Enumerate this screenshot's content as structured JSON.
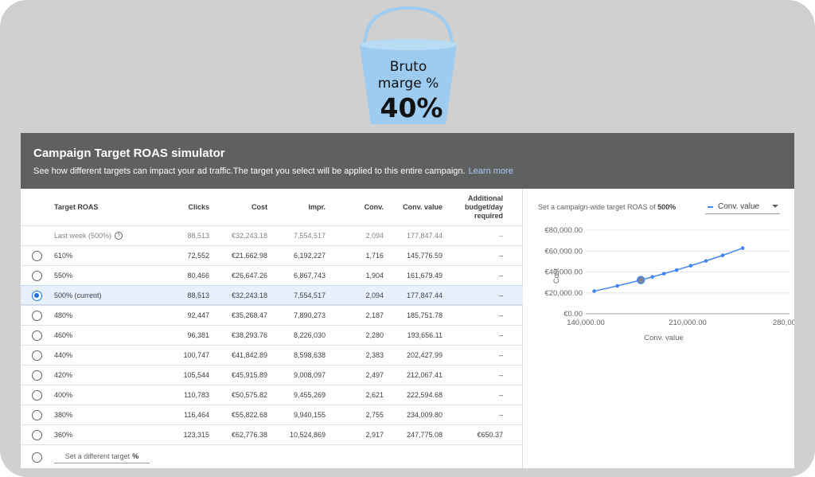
{
  "bucket": {
    "line1": "Bruto",
    "line2": "marge %",
    "percent": "40%",
    "color": "#9ecbf0"
  },
  "simulator": {
    "title": "Campaign Target ROAS simulator",
    "subtitle": "See how different targets can impact your ad traffic.The target you select will be applied to this entire campaign.",
    "learn_more": "Learn more"
  },
  "table": {
    "headers": {
      "target": "Target ROAS",
      "clicks": "Clicks",
      "cost": "Cost",
      "impr": "Impr.",
      "conv": "Conv.",
      "conv_value": "Conv. value",
      "budget1": "Additional",
      "budget2": "budget/day",
      "budget3": "required"
    },
    "last_week": {
      "target": "Last week (500%)",
      "clicks": "88,513",
      "cost": "€32,243.18",
      "impr": "7,554,517",
      "conv": "2,094",
      "conv_value": "177,847.44",
      "budget": "–"
    },
    "rows": [
      {
        "target": "610%",
        "clicks": "72,552",
        "cost": "€21,662.98",
        "impr": "6,192,227",
        "conv": "1,716",
        "conv_value": "145,776.59",
        "budget": "–"
      },
      {
        "target": "550%",
        "clicks": "80,466",
        "cost": "€26,647.26",
        "impr": "6,867,743",
        "conv": "1,904",
        "conv_value": "161,679.49",
        "budget": "–"
      },
      {
        "target": "500% (current)",
        "clicks": "88,513",
        "cost": "€32,243.18",
        "impr": "7,554,517",
        "conv": "2,094",
        "conv_value": "177,847.44",
        "budget": "–"
      },
      {
        "target": "480%",
        "clicks": "92,447",
        "cost": "€35,268.47",
        "impr": "7,890,273",
        "conv": "2,187",
        "conv_value": "185,751.78",
        "budget": "–"
      },
      {
        "target": "460%",
        "clicks": "96,381",
        "cost": "€38,293.76",
        "impr": "8,226,030",
        "conv": "2,280",
        "conv_value": "193,656.11",
        "budget": "–"
      },
      {
        "target": "440%",
        "clicks": "100,747",
        "cost": "€41,842.89",
        "impr": "8,598,638",
        "conv": "2,383",
        "conv_value": "202,427.99",
        "budget": "–"
      },
      {
        "target": "420%",
        "clicks": "105,544",
        "cost": "€45,915.89",
        "impr": "9,008,097",
        "conv": "2,497",
        "conv_value": "212,067.41",
        "budget": "–"
      },
      {
        "target": "400%",
        "clicks": "110,783",
        "cost": "€50,575.82",
        "impr": "9,455,269",
        "conv": "2,621",
        "conv_value": "222,594.68",
        "budget": "–"
      },
      {
        "target": "380%",
        "clicks": "116,464",
        "cost": "€55,822.68",
        "impr": "9,940,155",
        "conv": "2,755",
        "conv_value": "234,009.80",
        "budget": "–"
      },
      {
        "target": "360%",
        "clicks": "123,315",
        "cost": "€62,776.38",
        "impr": "10,524,869",
        "conv": "2,917",
        "conv_value": "247,775.08",
        "budget": "€650.37"
      }
    ],
    "selected_index": 2,
    "custom_target_placeholder": "Set a different target",
    "custom_target_unit": "%"
  },
  "chart_panel": {
    "label_prefix": "Set a campaign-wide target ROAS of",
    "label_value": "500%",
    "series_dropdown": "Conv. value"
  },
  "chart_data": {
    "type": "line",
    "xlabel": "Conv. value",
    "ylabel": "Cost",
    "x_ticks": [
      "140,000.00",
      "210,000.00",
      "280,000.0"
    ],
    "y_ticks": [
      "€0.00",
      "€20,000.00",
      "€40,000.00",
      "€60,000.00",
      "€80,000.00"
    ],
    "xlim": [
      140000,
      280000
    ],
    "ylim": [
      0,
      80000
    ],
    "grid": true,
    "series_color": "#4285f4",
    "highlight_index": 2,
    "series": [
      {
        "x": [
          145776.59,
          161679.49,
          177847.44,
          185751.78,
          193656.11,
          202427.99,
          212067.41,
          222594.68,
          234009.8,
          247775.08
        ],
        "y": [
          21662.98,
          26647.26,
          32243.18,
          35268.47,
          38293.76,
          41842.89,
          45915.89,
          50575.82,
          55822.68,
          62776.38
        ]
      }
    ]
  }
}
